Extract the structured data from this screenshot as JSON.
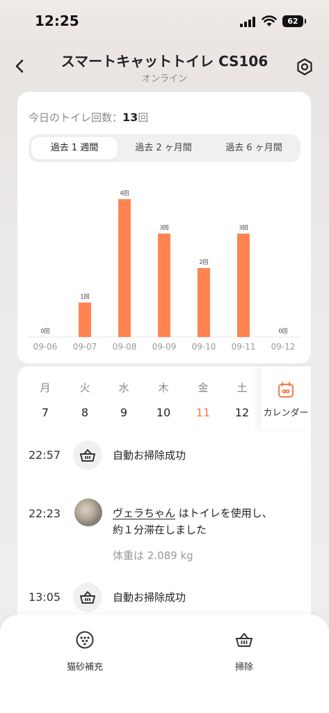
{
  "status_bar": {
    "time": "12:25",
    "battery": "62"
  },
  "nav": {
    "title": "スマートキャットトイレ CS106",
    "subtitle": "オンライン"
  },
  "summary": {
    "label": "今日のトイレ回数：",
    "count": "13",
    "unit": "回"
  },
  "tabs": [
    {
      "label": "過去 1 週間",
      "active": true
    },
    {
      "label": "過去 2 ヶ月間",
      "active": false
    },
    {
      "label": "過去 6 ヶ月間",
      "active": false
    }
  ],
  "chart_data": {
    "type": "bar",
    "categories": [
      "09-06",
      "09-07",
      "09-08",
      "09-09",
      "09-10",
      "09-11",
      "09-12"
    ],
    "values": [
      0,
      1,
      4,
      3,
      2,
      3,
      0
    ],
    "data_labels": [
      "0回",
      "1回",
      "4回",
      "3回",
      "2回",
      "3回",
      "0回"
    ],
    "ylim": [
      0,
      4
    ],
    "bar_color": "#ff8452",
    "grid": false
  },
  "week": {
    "days": [
      {
        "name": "月",
        "num": "7",
        "today": false
      },
      {
        "name": "火",
        "num": "8",
        "today": false
      },
      {
        "name": "水",
        "num": "9",
        "today": false
      },
      {
        "name": "木",
        "num": "10",
        "today": false
      },
      {
        "name": "金",
        "num": "11",
        "today": true
      },
      {
        "name": "土",
        "num": "12",
        "today": false
      }
    ],
    "calendar_label": "カレンダー"
  },
  "logs": [
    {
      "time": "22:57",
      "icon": "basket-icon",
      "text": "自動お掃除成功"
    },
    {
      "time": "22:23",
      "icon": "cat-avatar",
      "cat_name": "ヴェラちゃん",
      "text_after": " はトイレを使用し、",
      "text_line2": "約１分滞在しました",
      "weight": "体重は 2.089 kg"
    },
    {
      "time": "13:05",
      "icon": "basket-icon",
      "text": "自動お掃除成功"
    }
  ],
  "bottom_actions": [
    {
      "label": "猫砂補充",
      "icon": "litter-refill-icon"
    },
    {
      "label": "掃除",
      "icon": "basket-icon"
    }
  ],
  "colors": {
    "accent": "#ff8452",
    "today": "#f07a4a"
  }
}
